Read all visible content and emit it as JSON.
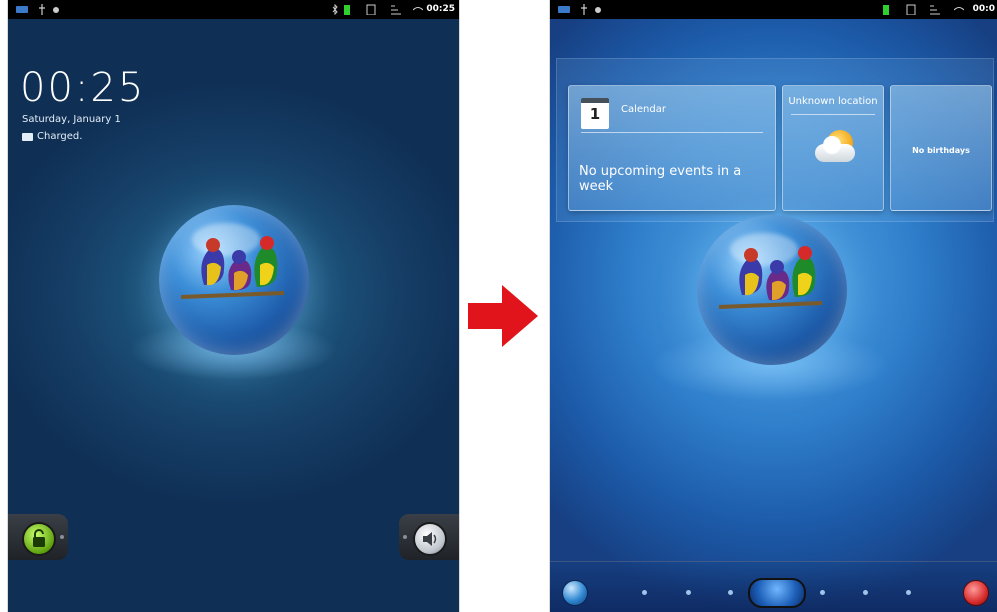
{
  "lock_screen": {
    "status_time": "00:25",
    "clock": "00:25",
    "date": "Saturday, January 1",
    "charge_status": "Charged.",
    "unlock_icon": "unlock-padlock-icon",
    "sound_icon": "speaker-icon"
  },
  "transition_arrow": {
    "icon": "right-arrow-icon",
    "color": "#e2141b"
  },
  "home_screen": {
    "status_time": "00:0",
    "widgets": {
      "calendar": {
        "day": "1",
        "title": "Calendar",
        "message": "No upcoming events in a week"
      },
      "weather": {
        "title": "Unknown location",
        "icon": "partly-cloudy-icon"
      },
      "birthdays": {
        "message": "No birthdays"
      }
    },
    "dock": {
      "left_icon": "globe-icon",
      "right_icon": "apps-grid-icon"
    }
  }
}
